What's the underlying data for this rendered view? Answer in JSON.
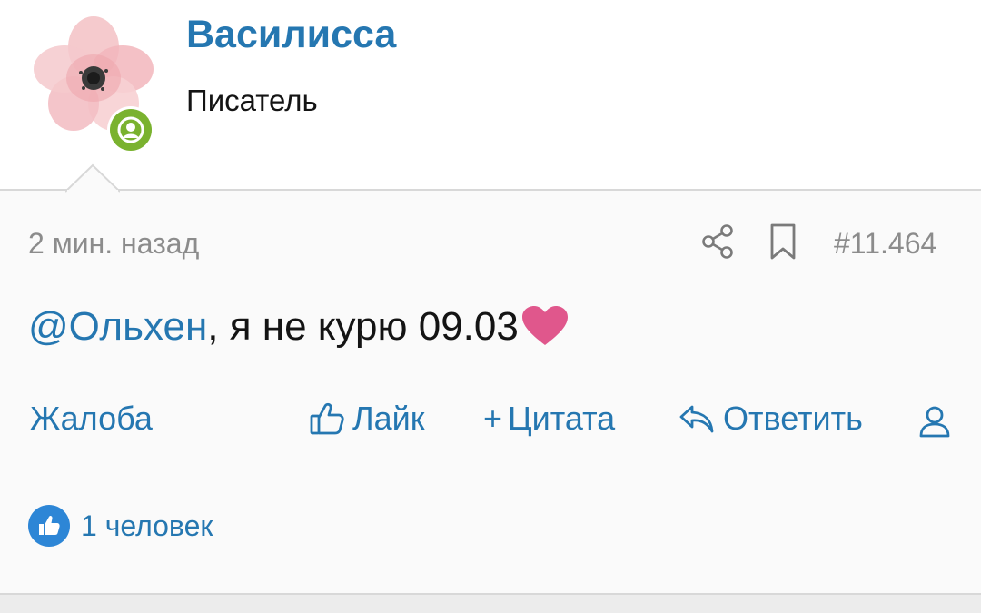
{
  "user": {
    "name": "Василисса",
    "title": "Писатель",
    "avatar_icon": "pink-flower-avatar",
    "status_icon": "online-user-icon",
    "status_color": "#7ab22f"
  },
  "post": {
    "time": "2 мин. назад",
    "number": "#11.464",
    "share_icon": "share-icon",
    "bookmark_icon": "bookmark-icon",
    "mention": "@Ольхен",
    "text": ", я не курю 09.03",
    "emoji": "heart-emoji"
  },
  "actions": {
    "report": "Жалоба",
    "like": "Лайк",
    "quote_prefix": "+",
    "quote": "Цитата",
    "reply": "Ответить",
    "user_icon": "user-icon"
  },
  "reactions": {
    "icon": "thumbs-up-icon",
    "summary": "1 человек"
  },
  "colors": {
    "accent": "#2577b1",
    "text": "#141414",
    "muted": "#8c8c8c",
    "heart": "#e0578c"
  }
}
